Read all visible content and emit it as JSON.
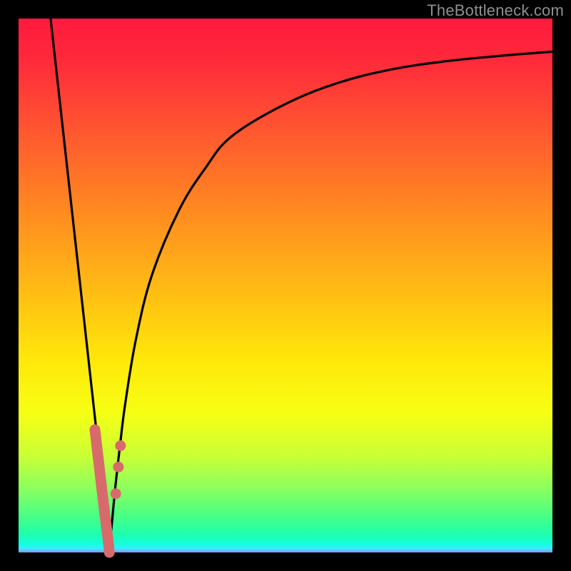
{
  "watermark": "TheBottleneck.com",
  "chart_data": {
    "type": "line",
    "title": "",
    "xlabel": "",
    "ylabel": "",
    "xlim": [
      0,
      100
    ],
    "ylim": [
      0,
      100
    ],
    "series": [
      {
        "name": "left-branch",
        "x": [
          6,
          8,
          10,
          12,
          14,
          15,
          16,
          17
        ],
        "values": [
          100,
          82,
          64,
          46,
          28,
          19,
          10,
          0
        ]
      },
      {
        "name": "right-branch",
        "x": [
          17,
          18,
          19,
          20,
          22,
          25,
          30,
          35,
          40,
          50,
          60,
          70,
          80,
          90,
          100
        ],
        "values": [
          0,
          11,
          20,
          28,
          40,
          52,
          64,
          72,
          78,
          84,
          88,
          90.5,
          92,
          93,
          93.8
        ]
      },
      {
        "name": "highlight-dots",
        "x": [
          14.5,
          15.0,
          15.5,
          16.0,
          16.4,
          16.8,
          17.0,
          17.3,
          18.2,
          18.7,
          19.1
        ],
        "values": [
          22,
          18,
          13,
          8,
          4,
          1,
          0,
          2,
          11,
          16,
          20
        ]
      }
    ],
    "highlight_color": "#d76b6b",
    "curve_color": "#000000",
    "gradient_stops": [
      {
        "pos": 0.0,
        "color": "#ff1a3d"
      },
      {
        "pos": 0.22,
        "color": "#ff5a2f"
      },
      {
        "pos": 0.5,
        "color": "#ffb915"
      },
      {
        "pos": 0.74,
        "color": "#f6ff14"
      },
      {
        "pos": 0.93,
        "color": "#4cff84"
      },
      {
        "pos": 1.0,
        "color": "#9090ff"
      }
    ]
  }
}
